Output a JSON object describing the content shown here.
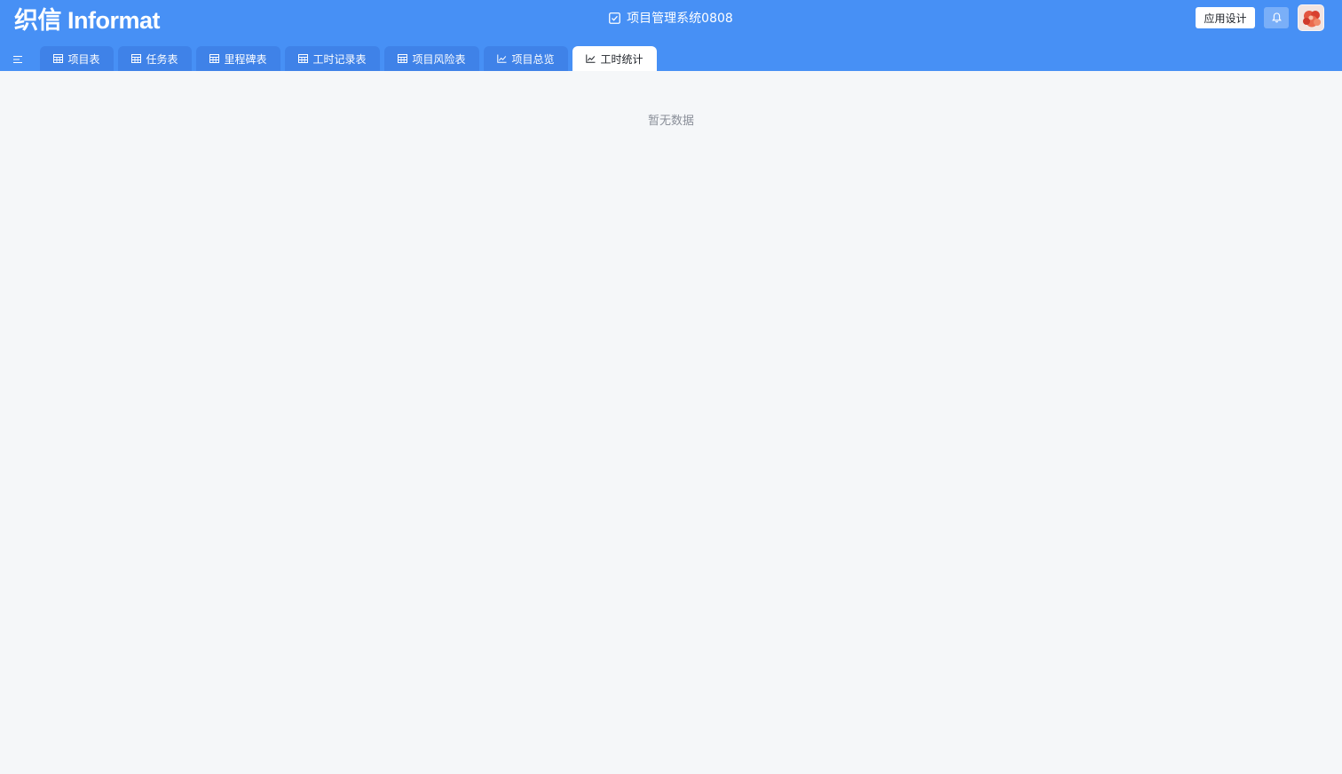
{
  "header": {
    "logo_text": "织信 Informat",
    "app_title": "项目管理系统0808",
    "app_icon": "checkbox-icon",
    "design_button": "应用设计",
    "bell_icon": "bell-icon",
    "avatar_icon": "avatar",
    "colors": {
      "header_bg": "#4790f5",
      "tab_bg": "#3f82e8",
      "active_tab_bg": "#ffffff",
      "page_bg": "#f5f7f9"
    }
  },
  "tabs": [
    {
      "label": "项目表",
      "icon": "table-icon"
    },
    {
      "label": "任务表",
      "icon": "table-icon"
    },
    {
      "label": "里程碑表",
      "icon": "table-icon"
    },
    {
      "label": "工时记录表",
      "icon": "table-icon"
    },
    {
      "label": "项目风险表",
      "icon": "table-icon"
    },
    {
      "label": "项目总览",
      "icon": "chart-icon"
    },
    {
      "label": "工时统计",
      "icon": "chart-icon",
      "active": true
    }
  ],
  "main": {
    "empty_text": "暂无数据"
  }
}
